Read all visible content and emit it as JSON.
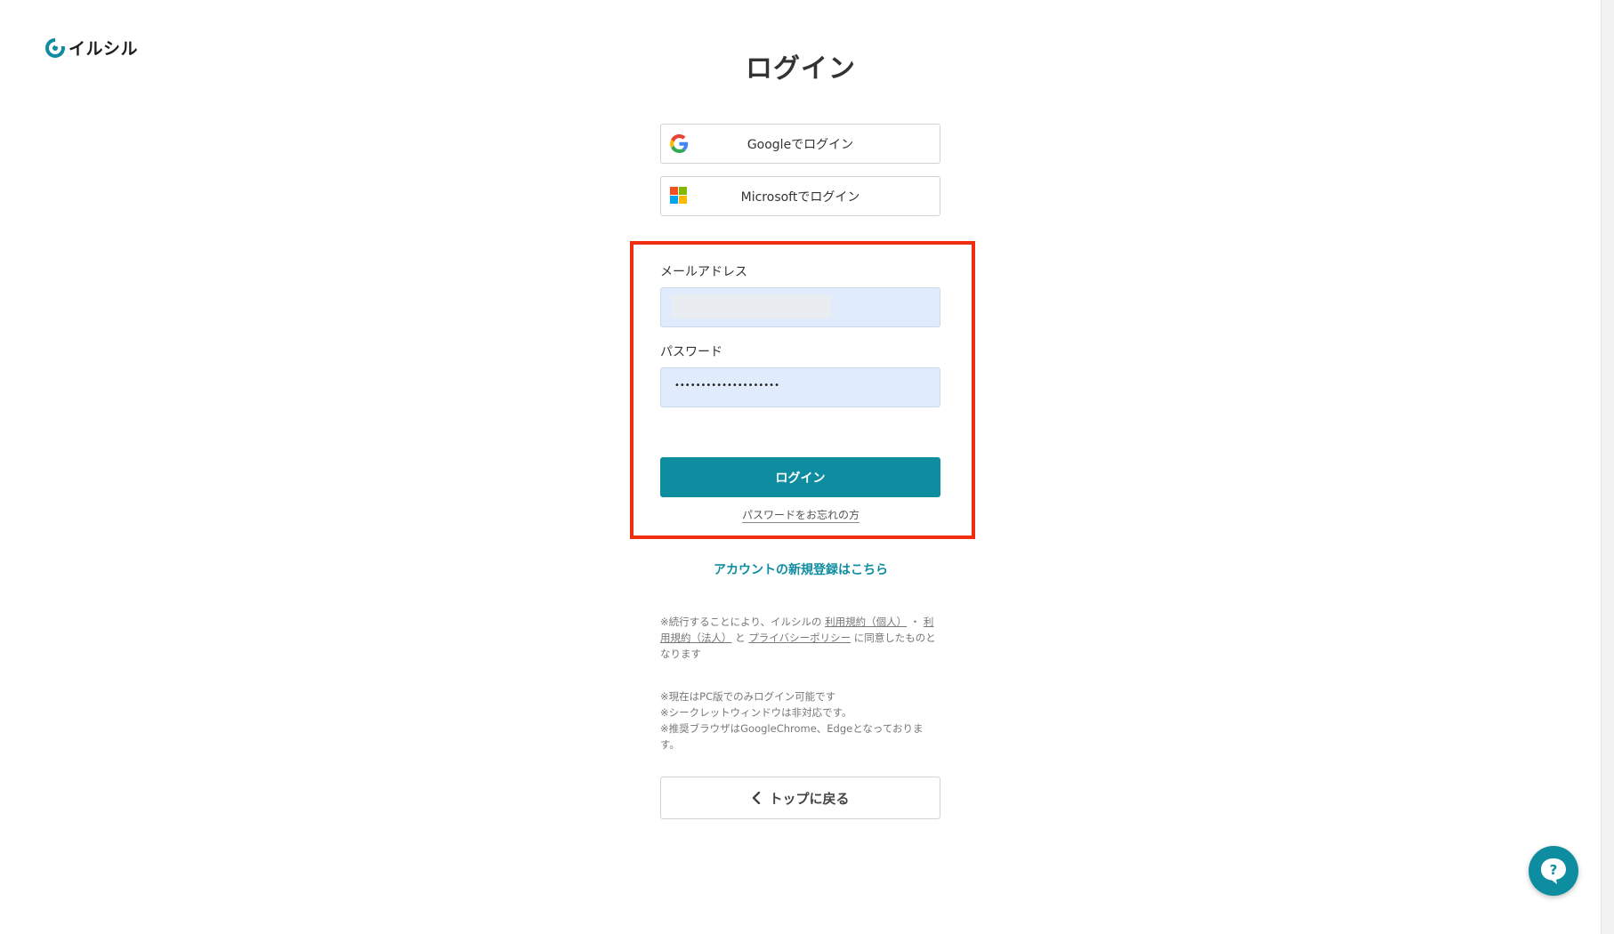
{
  "brand": {
    "name": "イルシル",
    "accent_color": "#0e8ca0",
    "logo_icon": "ilshil-logo-icon"
  },
  "page": {
    "title": "ログイン"
  },
  "sso": {
    "google_label": "Googleでログイン",
    "google_icon": "google-icon",
    "microsoft_label": "Microsoftでログイン",
    "microsoft_icon": "microsoft-icon"
  },
  "form": {
    "email_label": "メールアドレス",
    "email_value": "",
    "password_label": "パスワード",
    "password_value": "••••••••••••••••••••",
    "submit_label": "ログイン",
    "forgot_label": "パスワードをお忘れの方",
    "highlight_color": "#ee2e0f",
    "input_bg_color": "#e0ecfc"
  },
  "signup": {
    "label": "アカウントの新規登録はこちら"
  },
  "terms": {
    "prefix": "※続行することにより、イルシルの",
    "link_personal": "利用規約（個人）",
    "separator": "・",
    "link_corporate": "利用規約（法人）",
    "and": "と",
    "link_privacy": "プライバシーポリシー",
    "suffix": "に同意したものとなります"
  },
  "notes": [
    "※現在はPC版でのみログイン可能です",
    "※シークレットウィンドウは非対応です。",
    "※推奨ブラウザはGoogleChrome、Edgeとなっております。"
  ],
  "back": {
    "label": "トップに戻る",
    "icon": "chevron-left-icon"
  },
  "help": {
    "icon": "question-icon"
  }
}
